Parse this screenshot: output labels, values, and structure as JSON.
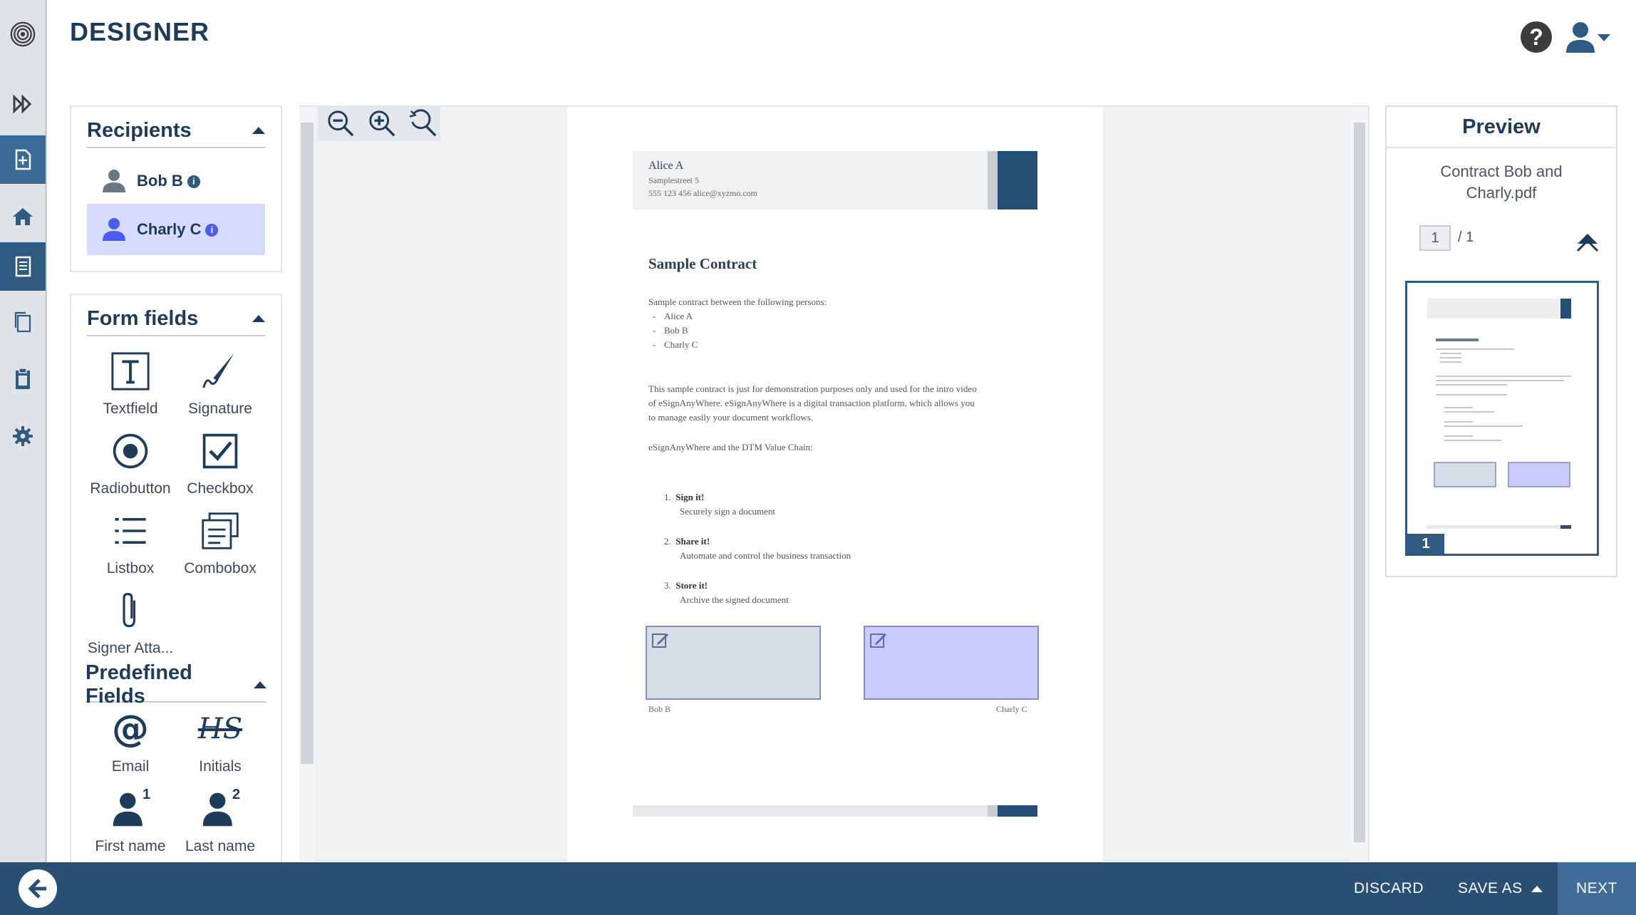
{
  "app": {
    "title": "DESIGNER"
  },
  "recipients": {
    "title": "Recipients",
    "items": [
      {
        "name": "Bob B",
        "color": "#2f5b83"
      },
      {
        "name": "Charly C",
        "color": "#4b5cf0"
      }
    ]
  },
  "form_fields": {
    "title": "Form fields",
    "items": [
      {
        "label": "Textfield",
        "icon": "textfield-icon"
      },
      {
        "label": "Signature",
        "icon": "signature-icon"
      },
      {
        "label": "Radiobutton",
        "icon": "radiobutton-icon"
      },
      {
        "label": "Checkbox",
        "icon": "checkbox-icon"
      },
      {
        "label": "Listbox",
        "icon": "listbox-icon"
      },
      {
        "label": "Combobox",
        "icon": "combobox-icon"
      },
      {
        "label": "Signer Atta...",
        "icon": "paperclip-icon"
      }
    ]
  },
  "predefined_fields": {
    "title": "Predefined Fields",
    "items": [
      {
        "label": "Email",
        "icon": "at-icon"
      },
      {
        "label": "Initials",
        "icon": "initials-icon",
        "glyph": "HS"
      },
      {
        "label": "First name",
        "icon": "user-one-icon",
        "superscript": "1"
      },
      {
        "label": "Last name",
        "icon": "user-two-icon",
        "superscript": "2"
      }
    ]
  },
  "document": {
    "sender_name": "Alice A",
    "sender_street": "Samplestreet 5",
    "sender_contact": "555 123 456  alice@xyzmo.com",
    "title": "Sample Contract",
    "intro": "Sample contract between the following persons:",
    "persons": [
      "Alice A",
      "Bob B",
      "Charly C"
    ],
    "paragraph_line1": "This sample contract is just for demonstration purposes only and used for the intro video",
    "paragraph_line2": "of eSignAnyWhere. eSignAnyWhere is a digital transaction platform, which allows you",
    "paragraph_line3": "to manage easily your document workflows.",
    "value_chain": "eSignAnyWhere and the DTM Value Chain:",
    "steps": [
      {
        "num": "1.",
        "title": "Sign it!",
        "desc": "Securely sign a document"
      },
      {
        "num": "2.",
        "title": "Share it!",
        "desc": "Automate and control the business transaction"
      },
      {
        "num": "3.",
        "title": "Store it!",
        "desc": "Archive the signed document"
      }
    ],
    "signature_labels": [
      "Bob B",
      "Charly C"
    ]
  },
  "preview": {
    "title": "Preview",
    "filename_line1": "Contract Bob and",
    "filename_line2": "Charly.pdf",
    "current_page": "1",
    "total_pages": "/ 1",
    "thumb_badge": "1"
  },
  "bottom_bar": {
    "discard": "DISCARD",
    "save_as": "SAVE AS",
    "next": "NEXT"
  },
  "colors": {
    "primary": "#2a4f74",
    "accent": "#2f5b83",
    "recipient_highlight": "#d7dbff",
    "sig_box_bob": "#d7dde6",
    "sig_box_charly": "#c9cbfa"
  }
}
